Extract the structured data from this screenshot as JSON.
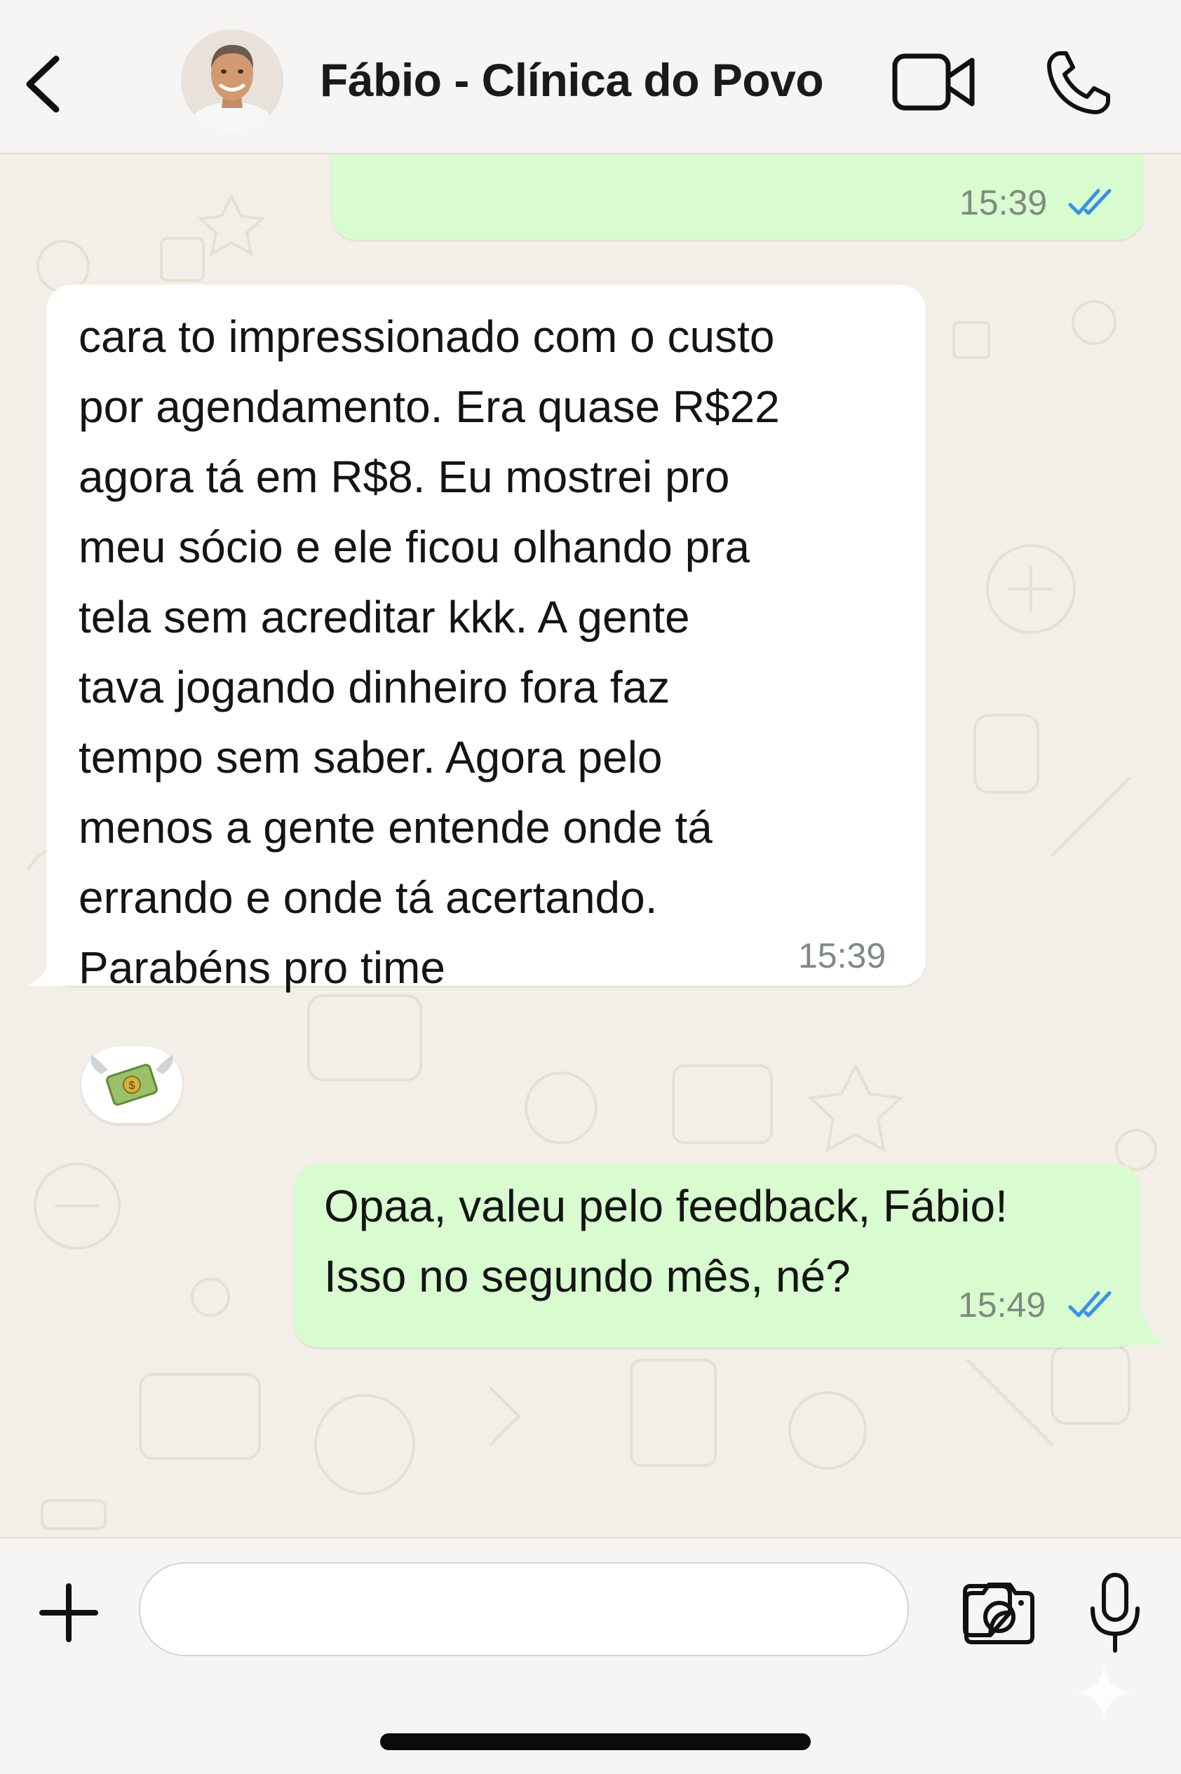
{
  "header": {
    "contact_name": "Fábio - Clínica do Povo",
    "back_icon": "chevron-left-icon",
    "video_icon": "video-camera-icon",
    "call_icon": "phone-icon"
  },
  "messages": [
    {
      "direction": "outgoing",
      "text": "",
      "time": "15:39",
      "status": "read"
    },
    {
      "direction": "incoming",
      "text": "cara to impressionado com o custo\npor agendamento. Era quase R$22\nagora tá em R$8. Eu mostrei pro\nmeu sócio e ele ficou olhando pra\ntela sem acreditar kkk. A gente\ntava jogando dinheiro fora faz\ntempo sem saber. Agora pelo\nmenos a gente entende onde tá\nerrando e onde tá acertando.\nParabéns pro time",
      "time": "15:39",
      "reaction": "💸"
    },
    {
      "direction": "outgoing",
      "text": "Opaa, valeu pelo feedback, Fábio!\nIsso no segundo mês, né?",
      "time": "15:49",
      "status": "read"
    }
  ],
  "composer": {
    "placeholder": "",
    "value": "",
    "plus_icon": "plus-icon",
    "sticker_icon": "sticker-icon",
    "camera_icon": "camera-icon",
    "mic_icon": "microphone-icon"
  },
  "colors": {
    "outgoing_bubble": "#d8fbcf",
    "incoming_bubble": "#ffffff",
    "read_ticks": "#3b8fe6",
    "wallpaper": "#f3efe8"
  }
}
